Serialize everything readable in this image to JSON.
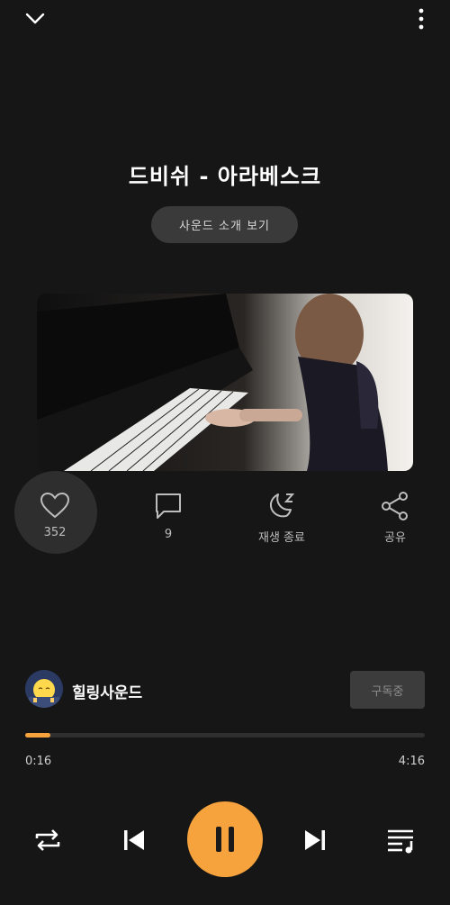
{
  "header": {
    "back_icon": "chevron-down-icon",
    "more_icon": "more-vertical-icon"
  },
  "track": {
    "title": "드비쉬 - 아라베스크",
    "intro_button": "사운드 소개 보기"
  },
  "actions": {
    "like": {
      "icon": "heart-icon",
      "count": "352"
    },
    "comment": {
      "icon": "comment-icon",
      "count": "9"
    },
    "sleep_timer": {
      "icon": "moon-icon",
      "label": "재생 종료"
    },
    "share": {
      "icon": "share-icon",
      "label": "공유"
    }
  },
  "channel": {
    "name": "힐링사운드",
    "subscribe_label": "구독중"
  },
  "progress": {
    "current": "0:16",
    "total": "4:16",
    "fraction": 0.0625,
    "color": "#f7a33d"
  },
  "controls": {
    "repeat_icon": "repeat-icon",
    "prev_icon": "skip-previous-icon",
    "play_pause_icon": "pause-icon",
    "next_icon": "skip-next-icon",
    "playlist_icon": "playlist-icon"
  }
}
